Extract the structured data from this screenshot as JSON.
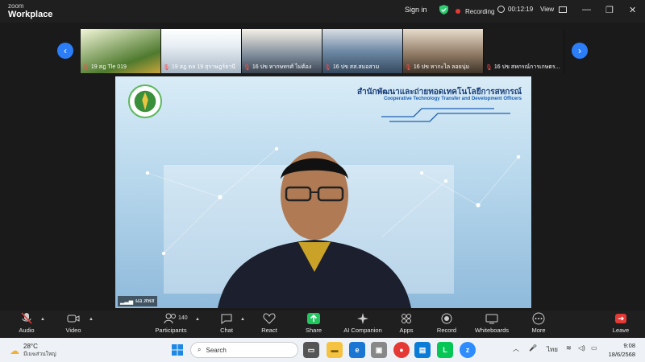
{
  "app": {
    "brand_top": "zoom",
    "brand_name": "Workplace"
  },
  "titlebar": {
    "signin": "Sign in",
    "recording": "Recording",
    "timer": "00:12:19",
    "view": "View"
  },
  "gallery": {
    "participants": [
      {
        "name": "19 สฎ Tle 019"
      },
      {
        "name": "19 สฎ ตล 19 สุราษฎร์ธานี"
      },
      {
        "name": "16 ปข หากษทรศ์ ไม่ต้อง"
      },
      {
        "name": "16 ปข สส.สมอสาม"
      },
      {
        "name": "16 ปข หากะไล ลอยนุ่ม"
      },
      {
        "name": "16 ปข สหกรณ์การเกษตร..."
      }
    ]
  },
  "main_video": {
    "org_thai": "สำนักพัฒนาและถ่ายทอดเทคโนโลยีการสหกรณ์",
    "org_english": "Cooperative Technology Transfer and Development Officers",
    "speaker_name": "ผอ.สพส"
  },
  "toolbar": {
    "audio": "Audio",
    "video": "Video",
    "participants": "Participants",
    "participant_count": "140",
    "chat": "Chat",
    "react": "React",
    "share": "Share",
    "ai_companion": "AI Companion",
    "apps": "Apps",
    "record": "Record",
    "whiteboards": "Whiteboards",
    "more": "More",
    "leave": "Leave"
  },
  "taskbar": {
    "temperature": "28°C",
    "weather_desc": "มีเมฆส่วนใหญ่",
    "search": "Search",
    "language": "ไทย",
    "time": "9:08",
    "date": "18/6/2568"
  },
  "colors": {
    "accent": "#2c7ef8",
    "record_red": "#e53935",
    "share_green": "#22c55e",
    "leave_red": "#e53935"
  }
}
